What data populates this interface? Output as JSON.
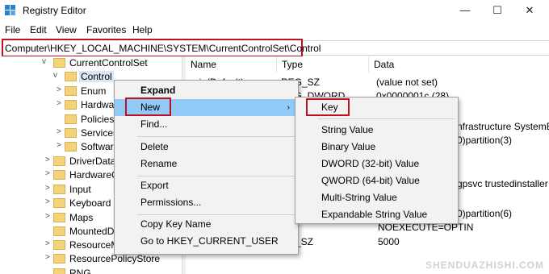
{
  "window": {
    "title": "Registry Editor",
    "minimize_glyph": "—",
    "maximize_glyph": "☐",
    "close_glyph": "✕"
  },
  "menu": [
    "File",
    "Edit",
    "View",
    "Favorites",
    "Help"
  ],
  "address": "Computer\\HKEY_LOCAL_MACHINE\\SYSTEM\\CurrentControlSet\\Control",
  "tree": [
    {
      "label": "CurrentControlSet",
      "expander": "v"
    },
    {
      "label": "Control",
      "expander": "v"
    },
    {
      "label": "Enum",
      "expander": ">"
    },
    {
      "label": "Hardwa",
      "expander": ">"
    },
    {
      "label": "Policies",
      "expander": ""
    },
    {
      "label": "Services",
      "expander": ">"
    },
    {
      "label": "Software",
      "expander": ">"
    },
    {
      "label": "DriverDatab",
      "expander": ">"
    },
    {
      "label": "HardwareC",
      "expander": ">"
    },
    {
      "label": "Input",
      "expander": ">"
    },
    {
      "label": "Keyboard L",
      "expander": ">"
    },
    {
      "label": "Maps",
      "expander": ">"
    },
    {
      "label": "MountedD",
      "expander": ""
    },
    {
      "label": "ResourceM",
      "expander": ">"
    },
    {
      "label": "ResourcePolicyStore",
      "expander": ">"
    },
    {
      "label": "RNG",
      "expander": ""
    }
  ],
  "list": {
    "columns": [
      "Name",
      "Type",
      "Data"
    ],
    "cells": {
      "default_name": "(Default)",
      "row1_type": "REG_SZ",
      "row1_data": "(value not set)",
      "row2_type": "REG_DWORD",
      "row2_data": "0x0000001c (28)",
      "data_infra": "nfrastructure SystemEv",
      "data_part3": "0)partition(3)",
      "data_gpsvc": "gpsvc trustedinstaller",
      "data_part6": "0)partition(6)",
      "data_noexec": "NOEXECUTE=OPTIN",
      "type_sz": "_SZ",
      "data_5000": "5000"
    }
  },
  "context_menu": {
    "items": [
      "Expand",
      "New",
      "Find...",
      "Delete",
      "Rename",
      "Export",
      "Permissions...",
      "Copy Key Name",
      "Go to HKEY_CURRENT_USER"
    ],
    "submenu_arrow": "›"
  },
  "submenu": {
    "items": [
      "Key",
      "String Value",
      "Binary Value",
      "DWORD (32-bit) Value",
      "QWORD (64-bit) Value",
      "Multi-String Value",
      "Expandable String Value"
    ]
  },
  "watermark": "SHENDUAZHISHI.COM",
  "colors": {
    "highlight": "#91c9f7",
    "annotation_red": "#c0101f",
    "selection": "#d9e7f8",
    "folder": "#f3d27a"
  }
}
